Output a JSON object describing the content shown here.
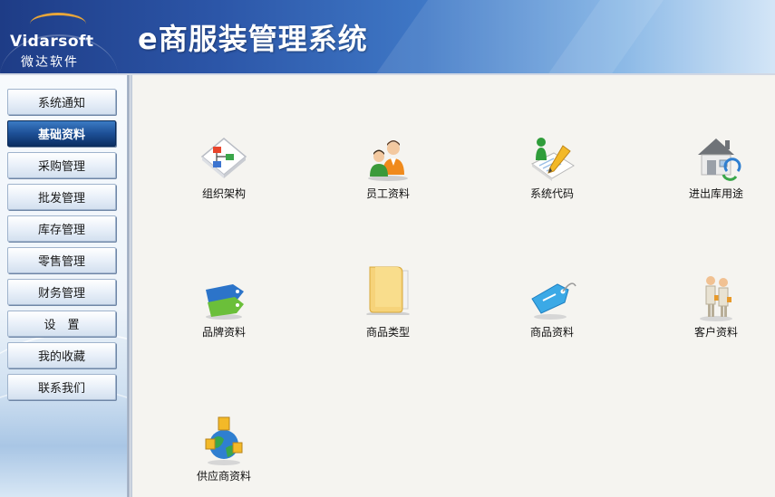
{
  "header": {
    "logo_name": "Vidarsoft",
    "logo_cn": "微达软件",
    "title": "e商服装管理系统"
  },
  "sidebar": {
    "items": [
      {
        "label": "系统通知",
        "active": false
      },
      {
        "label": "基础资料",
        "active": true
      },
      {
        "label": "采购管理",
        "active": false
      },
      {
        "label": "批发管理",
        "active": false
      },
      {
        "label": "库存管理",
        "active": false
      },
      {
        "label": "零售管理",
        "active": false
      },
      {
        "label": "财务管理",
        "active": false
      },
      {
        "label": "设　置",
        "active": false
      },
      {
        "label": "我的收藏",
        "active": false
      },
      {
        "label": "联系我们",
        "active": false
      }
    ]
  },
  "main": {
    "tiles": [
      {
        "label": "组织架构",
        "icon": "org-chart-icon"
      },
      {
        "label": "员工资料",
        "icon": "employees-icon"
      },
      {
        "label": "系统代码",
        "icon": "system-code-icon"
      },
      {
        "label": "进出库用途",
        "icon": "warehouse-house-icon"
      },
      {
        "label": "品牌资料",
        "icon": "brand-tags-icon"
      },
      {
        "label": "商品类型",
        "icon": "folder-icon"
      },
      {
        "label": "商品资料",
        "icon": "product-tag-icon"
      },
      {
        "label": "客户资料",
        "icon": "customers-icon"
      },
      {
        "label": "供应商资料",
        "icon": "supplier-globe-icon"
      }
    ]
  },
  "colors": {
    "header_dark": "#1e3c86",
    "active_nav": "#1d4f96",
    "logo_accent": "#e8a63a"
  }
}
